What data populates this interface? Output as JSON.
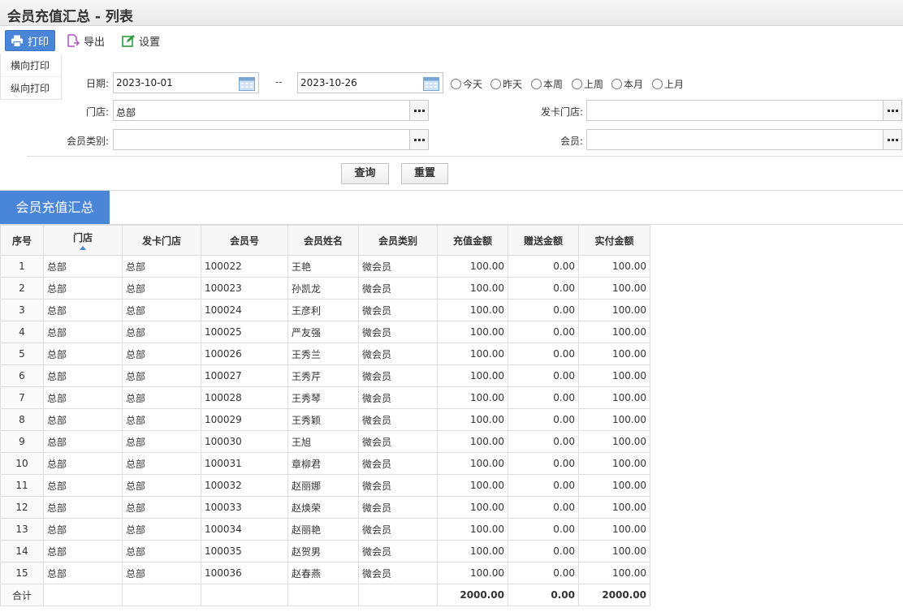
{
  "page_title": "会员充值汇总 - 列表",
  "toolbar": {
    "print_label": "打印",
    "export_label": "导出",
    "settings_label": "设置"
  },
  "print_menu": {
    "landscape": "横向打印",
    "portrait": "纵向打印"
  },
  "filters": {
    "date_label": "日期:",
    "date_from": "2023-10-01",
    "date_sep": "--",
    "date_to": "2023-10-26",
    "quick_ranges": [
      "今天",
      "昨天",
      "本周",
      "上周",
      "本月",
      "上月"
    ],
    "store_label": "门店:",
    "store_value": "总部",
    "card_store_label": "发卡门店:",
    "card_store_value": "",
    "member_type_label": "会员类别:",
    "member_type_value": "",
    "member_label": "会员:",
    "member_value": ""
  },
  "actions": {
    "query": "查询",
    "reset": "重置"
  },
  "section_title": "会员充值汇总",
  "table": {
    "columns": [
      "序号",
      "门店",
      "发卡门店",
      "会员号",
      "会员姓名",
      "会员类别",
      "充值金额",
      "赠送金额",
      "实付金额"
    ],
    "rows": [
      [
        "1",
        "总部",
        "总部",
        "100022",
        "王艳",
        "微会员",
        "100.00",
        "0.00",
        "100.00"
      ],
      [
        "2",
        "总部",
        "总部",
        "100023",
        "孙凯龙",
        "微会员",
        "100.00",
        "0.00",
        "100.00"
      ],
      [
        "3",
        "总部",
        "总部",
        "100024",
        "王彦利",
        "微会员",
        "100.00",
        "0.00",
        "100.00"
      ],
      [
        "4",
        "总部",
        "总部",
        "100025",
        "严友强",
        "微会员",
        "100.00",
        "0.00",
        "100.00"
      ],
      [
        "5",
        "总部",
        "总部",
        "100026",
        "王秀兰",
        "微会员",
        "100.00",
        "0.00",
        "100.00"
      ],
      [
        "6",
        "总部",
        "总部",
        "100027",
        "王秀芹",
        "微会员",
        "100.00",
        "0.00",
        "100.00"
      ],
      [
        "7",
        "总部",
        "总部",
        "100028",
        "王秀琴",
        "微会员",
        "100.00",
        "0.00",
        "100.00"
      ],
      [
        "8",
        "总部",
        "总部",
        "100029",
        "王秀颖",
        "微会员",
        "100.00",
        "0.00",
        "100.00"
      ],
      [
        "9",
        "总部",
        "总部",
        "100030",
        "王旭",
        "微会员",
        "100.00",
        "0.00",
        "100.00"
      ],
      [
        "10",
        "总部",
        "总部",
        "100031",
        "章柳君",
        "微会员",
        "100.00",
        "0.00",
        "100.00"
      ],
      [
        "11",
        "总部",
        "总部",
        "100032",
        "赵丽娜",
        "微会员",
        "100.00",
        "0.00",
        "100.00"
      ],
      [
        "12",
        "总部",
        "总部",
        "100033",
        "赵焕荣",
        "微会员",
        "100.00",
        "0.00",
        "100.00"
      ],
      [
        "13",
        "总部",
        "总部",
        "100034",
        "赵丽艳",
        "微会员",
        "100.00",
        "0.00",
        "100.00"
      ],
      [
        "14",
        "总部",
        "总部",
        "100035",
        "赵贺男",
        "微会员",
        "100.00",
        "0.00",
        "100.00"
      ],
      [
        "15",
        "总部",
        "总部",
        "100036",
        "赵春燕",
        "微会员",
        "100.00",
        "0.00",
        "100.00"
      ]
    ],
    "total": {
      "label": "合计",
      "recharge": "2000.00",
      "bonus": "0.00",
      "paid": "2000.00"
    }
  },
  "colors": {
    "accent": "#4a86d8"
  },
  "icons": {
    "print": "printer-icon",
    "export": "export-icon",
    "settings": "edit-icon",
    "calendar": "calendar-icon",
    "picker": "ellipsis-icon",
    "sort": "sort-asc-icon"
  }
}
